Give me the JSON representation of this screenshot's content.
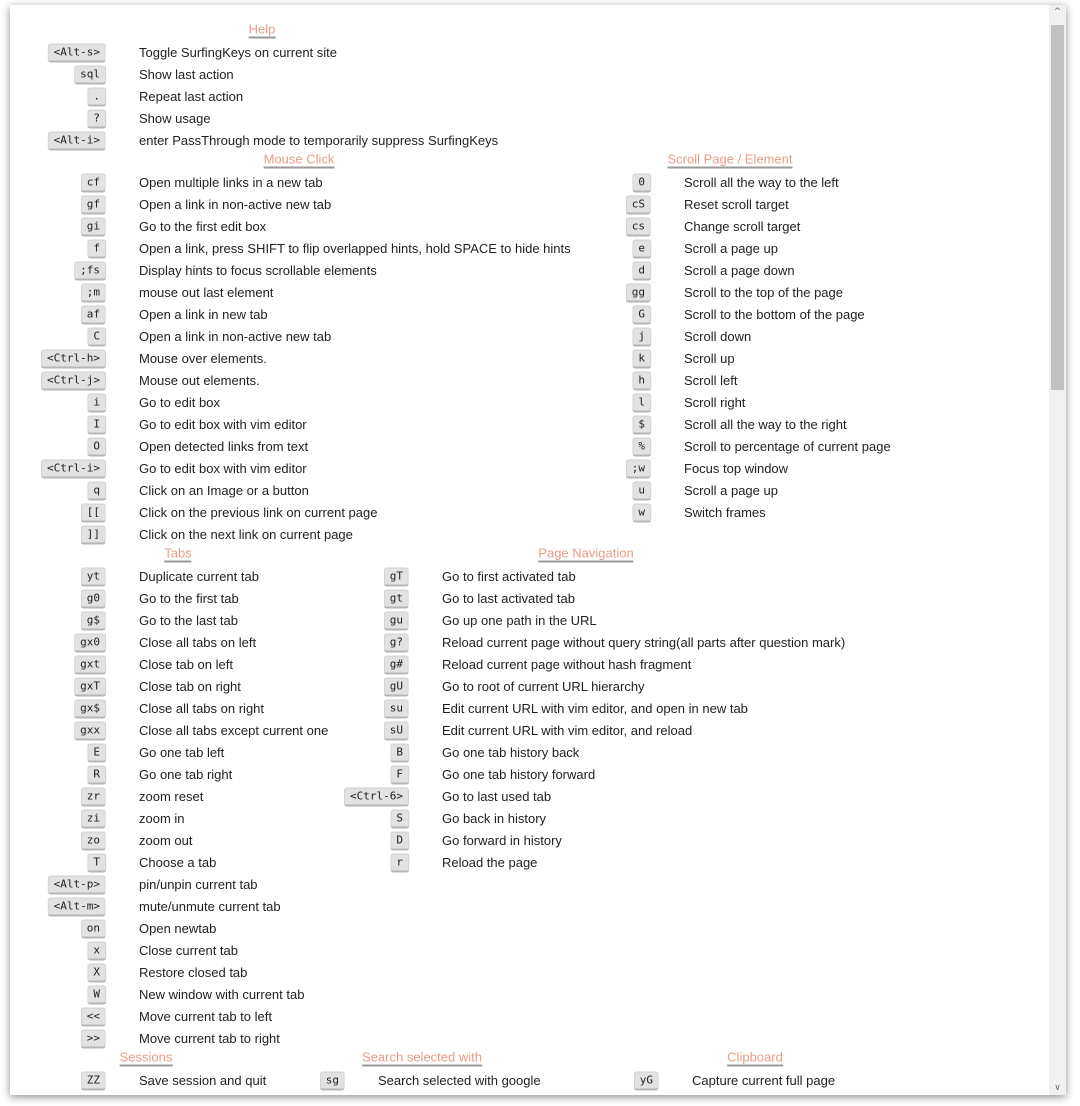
{
  "sections": [
    {
      "id": "help",
      "title": "Help",
      "items": [
        {
          "key": "<Alt-s>",
          "desc": "Toggle SurfingKeys on current site"
        },
        {
          "key": "sql",
          "desc": "Show last action"
        },
        {
          "key": ".",
          "desc": "Repeat last action"
        },
        {
          "key": "?",
          "desc": "Show usage"
        },
        {
          "key": "<Alt-i>",
          "desc": "enter PassThrough mode to temporarily suppress SurfingKeys"
        }
      ]
    },
    {
      "id": "mouse-click",
      "title": "Mouse Click",
      "items": [
        {
          "key": "cf",
          "desc": "Open multiple links in a new tab"
        },
        {
          "key": "gf",
          "desc": "Open a link in non-active new tab"
        },
        {
          "key": "gi",
          "desc": "Go to the first edit box"
        },
        {
          "key": "f",
          "desc": "Open a link, press SHIFT to flip overlapped hints, hold SPACE to hide hints"
        },
        {
          "key": ";fs",
          "desc": "Display hints to focus scrollable elements"
        },
        {
          "key": ";m",
          "desc": "mouse out last element"
        },
        {
          "key": "af",
          "desc": "Open a link in new tab"
        },
        {
          "key": "C",
          "desc": "Open a link in non-active new tab"
        },
        {
          "key": "<Ctrl-h>",
          "desc": "Mouse over elements."
        },
        {
          "key": "<Ctrl-j>",
          "desc": "Mouse out elements."
        },
        {
          "key": "i",
          "desc": "Go to edit box"
        },
        {
          "key": "I",
          "desc": "Go to edit box with vim editor"
        },
        {
          "key": "O",
          "desc": "Open detected links from text"
        },
        {
          "key": "<Ctrl-i>",
          "desc": "Go to edit box with vim editor"
        },
        {
          "key": "q",
          "desc": "Click on an Image or a button"
        },
        {
          "key": "[[",
          "desc": "Click on the previous link on current page"
        },
        {
          "key": "]]",
          "desc": "Click on the next link on current page"
        }
      ]
    },
    {
      "id": "scroll",
      "title": "Scroll Page / Element",
      "items": [
        {
          "key": "0",
          "desc": "Scroll all the way to the left"
        },
        {
          "key": "cS",
          "desc": "Reset scroll target"
        },
        {
          "key": "cs",
          "desc": "Change scroll target"
        },
        {
          "key": "e",
          "desc": "Scroll a page up"
        },
        {
          "key": "d",
          "desc": "Scroll a page down"
        },
        {
          "key": "gg",
          "desc": "Scroll to the top of the page"
        },
        {
          "key": "G",
          "desc": "Scroll to the bottom of the page"
        },
        {
          "key": "j",
          "desc": "Scroll down"
        },
        {
          "key": "k",
          "desc": "Scroll up"
        },
        {
          "key": "h",
          "desc": "Scroll left"
        },
        {
          "key": "l",
          "desc": "Scroll right"
        },
        {
          "key": "$",
          "desc": "Scroll all the way to the right"
        },
        {
          "key": "%",
          "desc": "Scroll to percentage of current page"
        },
        {
          "key": ";w",
          "desc": "Focus top window"
        },
        {
          "key": "u",
          "desc": "Scroll a page up"
        },
        {
          "key": "w",
          "desc": "Switch frames"
        }
      ]
    },
    {
      "id": "tabs",
      "title": "Tabs",
      "items": [
        {
          "key": "yt",
          "desc": "Duplicate current tab"
        },
        {
          "key": "g0",
          "desc": "Go to the first tab"
        },
        {
          "key": "g$",
          "desc": "Go to the last tab"
        },
        {
          "key": "gx0",
          "desc": "Close all tabs on left"
        },
        {
          "key": "gxt",
          "desc": "Close tab on left"
        },
        {
          "key": "gxT",
          "desc": "Close tab on right"
        },
        {
          "key": "gx$",
          "desc": "Close all tabs on right"
        },
        {
          "key": "gxx",
          "desc": "Close all tabs except current one"
        },
        {
          "key": "E",
          "desc": "Go one tab left"
        },
        {
          "key": "R",
          "desc": "Go one tab right"
        },
        {
          "key": "zr",
          "desc": "zoom reset"
        },
        {
          "key": "zi",
          "desc": "zoom in"
        },
        {
          "key": "zo",
          "desc": "zoom out"
        },
        {
          "key": "T",
          "desc": "Choose a tab"
        },
        {
          "key": "<Alt-p>",
          "desc": "pin/unpin current tab"
        },
        {
          "key": "<Alt-m>",
          "desc": "mute/unmute current tab"
        },
        {
          "key": "on",
          "desc": "Open newtab"
        },
        {
          "key": "x",
          "desc": "Close current tab"
        },
        {
          "key": "X",
          "desc": "Restore closed tab"
        },
        {
          "key": "W",
          "desc": "New window with current tab"
        },
        {
          "key": "<<",
          "desc": "Move current tab to left"
        },
        {
          "key": ">>",
          "desc": "Move current tab to right"
        }
      ]
    },
    {
      "id": "page-navigation",
      "title": "Page Navigation",
      "items": [
        {
          "key": "gT",
          "desc": "Go to first activated tab"
        },
        {
          "key": "gt",
          "desc": "Go to last activated tab"
        },
        {
          "key": "gu",
          "desc": "Go up one path in the URL"
        },
        {
          "key": "g?",
          "desc": "Reload current page without query string(all parts after question mark)"
        },
        {
          "key": "g#",
          "desc": "Reload current page without hash fragment"
        },
        {
          "key": "gU",
          "desc": "Go to root of current URL hierarchy"
        },
        {
          "key": "su",
          "desc": "Edit current URL with vim editor, and open in new tab"
        },
        {
          "key": "sU",
          "desc": "Edit current URL with vim editor, and reload"
        },
        {
          "key": "B",
          "desc": "Go one tab history back"
        },
        {
          "key": "F",
          "desc": "Go one tab history forward"
        },
        {
          "key": "<Ctrl-6>",
          "desc": "Go to last used tab"
        },
        {
          "key": "S",
          "desc": "Go back in history"
        },
        {
          "key": "D",
          "desc": "Go forward in history"
        },
        {
          "key": "r",
          "desc": "Reload the page"
        }
      ]
    },
    {
      "id": "sessions",
      "title": "Sessions",
      "items": [
        {
          "key": "ZZ",
          "desc": "Save session and quit"
        }
      ]
    },
    {
      "id": "search-selected",
      "title": "Search selected with",
      "items": [
        {
          "key": "sg",
          "desc": "Search selected with google"
        }
      ]
    },
    {
      "id": "clipboard",
      "title": "Clipboard",
      "items": [
        {
          "key": "yG",
          "desc": "Capture current full page"
        }
      ]
    }
  ]
}
